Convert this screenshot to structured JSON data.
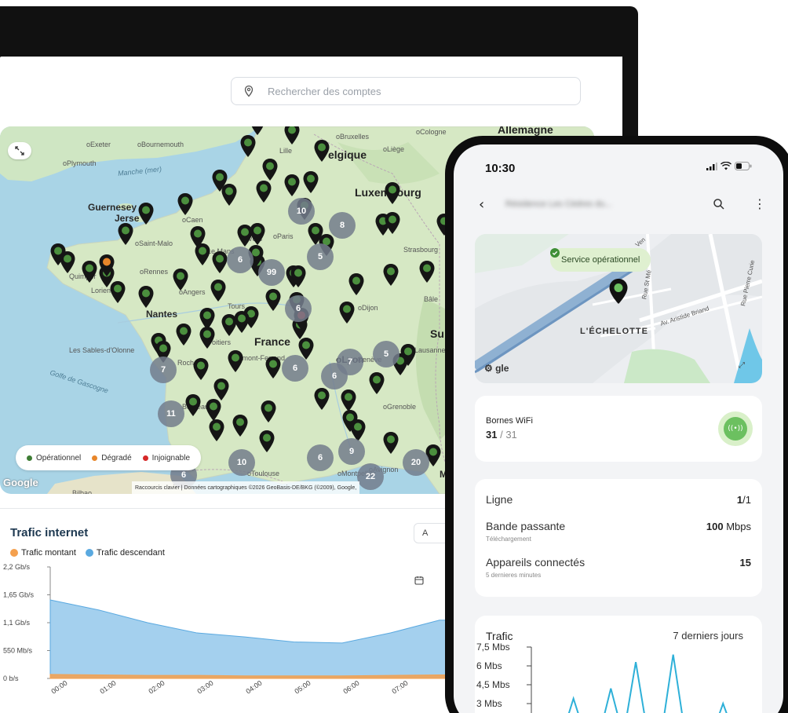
{
  "dashboard": {
    "search": {
      "placeholder": "Rechercher des comptes"
    },
    "map": {
      "cities": [
        {
          "name": "oExeter",
          "cls": "small"
        },
        {
          "name": "oBournemouth",
          "cls": "small"
        },
        {
          "name": "oPlymouth",
          "cls": "small"
        },
        {
          "name": "Manche (mer)",
          "cls": "sea"
        },
        {
          "name": "Guernesey",
          "cls": "mid"
        },
        {
          "name": "Jerse",
          "cls": "mid"
        },
        {
          "name": "oCaen",
          "cls": "small"
        },
        {
          "name": "oSaint-Malo",
          "cls": "small"
        },
        {
          "name": "oRennes",
          "cls": "small"
        },
        {
          "name": "Nantes",
          "cls": "mid"
        },
        {
          "name": "oAngers",
          "cls": "small"
        },
        {
          "name": "Tours",
          "cls": "small"
        },
        {
          "name": "Les Sables-d'Olonne",
          "cls": "small"
        },
        {
          "name": "Golfe de Gascogne",
          "cls": "sea"
        },
        {
          "name": "oBruxelles",
          "cls": "small"
        },
        {
          "name": "oCologne",
          "cls": "small"
        },
        {
          "name": "elgique",
          "cls": "big"
        },
        {
          "name": "Luxembourg",
          "cls": "big"
        },
        {
          "name": "Allemagne",
          "cls": "big"
        },
        {
          "name": "oParis",
          "cls": "small"
        },
        {
          "name": "Strasbourg",
          "cls": "small"
        },
        {
          "name": "oDijon",
          "cls": "small"
        },
        {
          "name": "France",
          "cls": "big"
        },
        {
          "name": "Clermont-Ferrand",
          "cls": "small"
        },
        {
          "name": "oLyon",
          "cls": "mid"
        },
        {
          "name": "Genève",
          "cls": "small"
        },
        {
          "name": "Lausanne",
          "cls": "small"
        },
        {
          "name": "oGrenoble",
          "cls": "small"
        },
        {
          "name": "Bordeaux",
          "cls": "small"
        },
        {
          "name": "oAvignon",
          "cls": "small"
        },
        {
          "name": "oMontpellier",
          "cls": "small"
        },
        {
          "name": "oToulouse",
          "cls": "small"
        },
        {
          "name": "Bilbao",
          "cls": "small"
        },
        {
          "name": "Monaco",
          "cls": "mid"
        },
        {
          "name": "Su",
          "cls": "big"
        },
        {
          "name": "Bâle",
          "cls": "small"
        },
        {
          "name": "Lille",
          "cls": "small"
        },
        {
          "name": "oLiège",
          "cls": "small"
        },
        {
          "name": "Le Mans",
          "cls": "small"
        },
        {
          "name": "Poitiers",
          "cls": "small"
        },
        {
          "name": "Rochelle",
          "cls": "small"
        },
        {
          "name": "Quimper",
          "cls": "small"
        },
        {
          "name": "Lorient",
          "cls": "small"
        },
        {
          "name": "Vers",
          "cls": "small"
        }
      ],
      "clusters": [
        "10",
        "8",
        "6",
        "99",
        "5",
        "6",
        "7",
        "6",
        "6",
        "7",
        "5",
        "11",
        "10",
        "6",
        "9",
        "22",
        "20",
        "6"
      ],
      "legend": [
        {
          "label": "Opérationnel",
          "color": "#3e7d34"
        },
        {
          "label": "Dégradé",
          "color": "#e8862a"
        },
        {
          "label": "Injoignable",
          "color": "#d62828"
        }
      ],
      "attribution": "Raccourcis clavier  |  Données cartographiques ©2026 GeoBasis-DE/BKG (©2009), Google,",
      "google_logo": "Google"
    },
    "traffic": {
      "title": "Trafic internet",
      "date_button": "A",
      "legend": [
        {
          "label": "Trafic montant",
          "color": "#f4a04e"
        },
        {
          "label": "Trafic descendant",
          "color": "#5aa9e0"
        }
      ]
    }
  },
  "chart_data": [
    {
      "type": "area",
      "title": "Trafic internet",
      "y_tick_labels": [
        "2,2 Gb/s",
        "1,65 Gb/s",
        "1,1 Gb/s",
        "550 Mb/s",
        "0 b/s"
      ],
      "y_tick_values": [
        2.2,
        1.65,
        1.1,
        0.55,
        0
      ],
      "ylim": [
        0,
        2.2
      ],
      "y_unit": "Gb/s",
      "x": [
        "00:00",
        "01:00",
        "02:00",
        "03:00",
        "04:00",
        "05:00",
        "06:00",
        "07:00"
      ],
      "series": [
        {
          "name": "Trafic descendant",
          "color": "#5aa9e0",
          "values": [
            1.55,
            1.35,
            1.1,
            0.9,
            0.82,
            0.72,
            0.7,
            0.9,
            1.15
          ]
        },
        {
          "name": "Trafic montant",
          "color": "#f4a04e",
          "values": [
            0.08,
            0.07,
            0.06,
            0.06,
            0.05,
            0.05,
            0.05,
            0.06,
            0.07
          ]
        }
      ],
      "grid": false
    },
    {
      "type": "line",
      "title": "Trafic",
      "period": "7 derniers jours",
      "y_tick_labels": [
        "7,5 Mbs",
        "6 Mbs",
        "4,5 Mbs",
        "3 Mbs"
      ],
      "y_tick_values": [
        7.5,
        6,
        4.5,
        3
      ],
      "values": [
        0.2,
        0.3,
        0.2,
        3.4,
        0.3,
        0.2,
        4.2,
        0.4,
        6.3,
        0.3,
        0.2,
        6.9,
        0.3,
        0.4,
        0.2,
        3.0,
        0.3,
        0.2
      ],
      "color": "#2eb0d8"
    }
  ],
  "phone": {
    "status": {
      "time": "10:30"
    },
    "site_name": "Résidence Les Cèdres du...",
    "service_status": "Service opérationnel",
    "area_label": "L'ÉCHELOTTE",
    "roads": [
      "Av. Aristide Briand",
      "Rue St Mé",
      "Rue Pierre Curie",
      "Ven"
    ],
    "google_logo": "gle",
    "wifi": {
      "title": "Bornes WiFi",
      "active": "31",
      "total": "31"
    },
    "line_card": {
      "ligne": {
        "label": "Ligne",
        "value": "1",
        "total": "1"
      },
      "bandwidth": {
        "label": "Bande passante",
        "sub": "Téléchargement",
        "value": "100",
        "unit": "Mbps"
      },
      "devices": {
        "label": "Appareils connectés",
        "sub": "5 dernieres minutes",
        "value": "15"
      }
    },
    "trafic": {
      "title": "Trafic",
      "period": "7 derniers jours"
    }
  }
}
